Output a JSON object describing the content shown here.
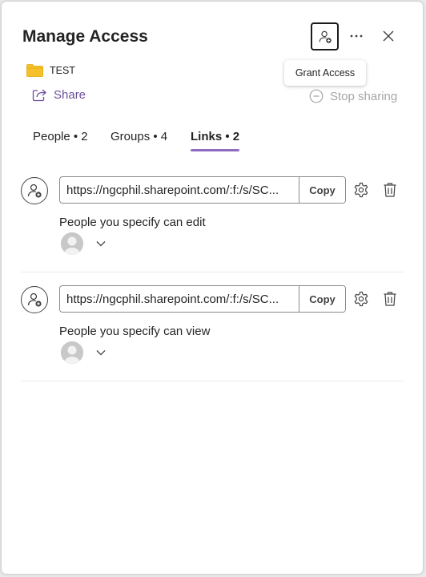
{
  "header": {
    "title": "Manage Access",
    "grant_access_tooltip": "Grant Access"
  },
  "item": {
    "name": "TEST",
    "share_label": "Share",
    "stop_sharing_label": "Stop sharing"
  },
  "tabs": [
    {
      "label": "People • 2",
      "active": false
    },
    {
      "label": "Groups • 4",
      "active": false
    },
    {
      "label": "Links • 2",
      "active": true
    }
  ],
  "links": [
    {
      "url": "https://ngcphil.sharepoint.com/:f:/s/SC...",
      "copy_label": "Copy",
      "permission": "People you specify can edit"
    },
    {
      "url": "https://ngcphil.sharepoint.com/:f:/s/SC...",
      "copy_label": "Copy",
      "permission": "People you specify can view"
    }
  ],
  "colors": {
    "accent": "#8e6cc0",
    "share_link": "#6b4f9e",
    "disabled_text": "#a6a6a6",
    "folder": "#f5c02b"
  },
  "icons": {
    "grant": "person-add-icon",
    "more": "more-horizontal-icon",
    "close": "close-icon",
    "folder": "folder-icon",
    "share": "share-icon",
    "stop": "stop-sharing-icon",
    "link_avatar": "person-add-icon",
    "gear": "gear-icon",
    "trash": "trash-icon",
    "person": "person-avatar-icon",
    "chevron": "chevron-down-icon"
  }
}
